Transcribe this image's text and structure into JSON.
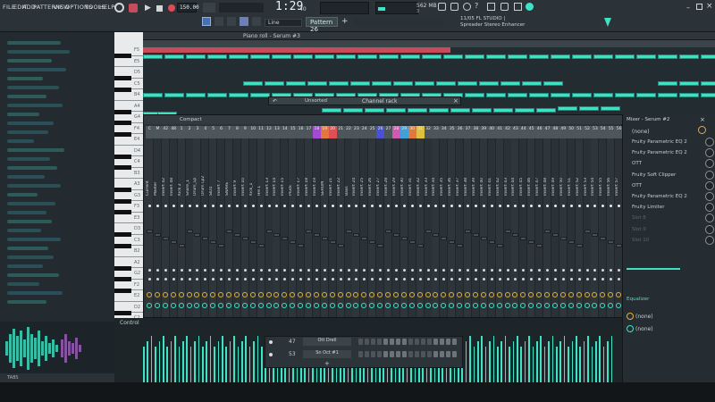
{
  "menu": {
    "file": "FILE",
    "edit": "EDIT",
    "add": "ADD",
    "patterns": "PATTERNS",
    "view": "VIEW",
    "options": "OPTIONS",
    "tools": "TOOLS",
    "help": "HELP"
  },
  "transport": {
    "tempo": "150.00",
    "time": "1:29",
    "time_small": "40",
    "pattern": "Pattern 26",
    "snap": "Line",
    "cpu": "562 MB",
    "cpu_small": "3"
  },
  "hint": {
    "version": "11/05 FL STUDIO |",
    "plugin": "Spreader Stereo Enhancer"
  },
  "piano_roll": {
    "title": "Piano roll - Serum #3"
  },
  "channel_rack": {
    "title": "Channel rack",
    "filter": "Unsorted",
    "compact": "Compact"
  },
  "piano_keys": [
    "F5",
    "E5",
    "D5",
    "C5",
    "B4",
    "A4",
    "G4",
    "F4",
    "E4",
    "D4",
    "C4",
    "B3",
    "A3",
    "G3",
    "F3",
    "E3",
    "D3",
    "C3",
    "B2",
    "A2",
    "G2",
    "F2",
    "E2",
    "D2",
    "C2",
    "B1",
    "A1",
    "G1",
    "F1",
    "E1",
    "D1"
  ],
  "mixer": {
    "track_numbers": [
      "C",
      "M",
      "42",
      "48",
      "1",
      "2",
      "3",
      "4",
      "5",
      "6",
      "7",
      "8",
      "9",
      "10",
      "11",
      "12",
      "13",
      "14",
      "15",
      "16",
      "17",
      "18",
      "19",
      "20",
      "21",
      "22",
      "23",
      "24",
      "25",
      "26",
      "27",
      "28",
      "29",
      "30",
      "31",
      "32",
      "33",
      "34",
      "35",
      "36",
      "37",
      "38",
      "39",
      "40",
      "41",
      "42",
      "43",
      "44",
      "45",
      "46",
      "47",
      "48",
      "49",
      "50",
      "51",
      "52",
      "53",
      "54",
      "55",
      "56",
      "57",
      "58"
    ],
    "track_names": [
      "Current",
      "Master",
      "Insert 42",
      "Insert 48",
      "Kick 2",
      "Snare_1",
      "Drum_Lp",
      "Drum Lp2",
      "SID1",
      "Insert 7",
      "SNARE",
      "Insert 9",
      "Insert 10",
      "Kick_1",
      "HH 1",
      "Insert 13",
      "Insert 14",
      "Insert 15",
      "Pluck",
      "Insert 17",
      "Insert 18",
      "Insert 19",
      "SERUM",
      "Insert 21",
      "Insert 22",
      "Bass",
      "Insert 24",
      "Insert 25",
      "Insert 26",
      "Insert 27",
      "Insert 28",
      "Insert 29",
      "Insert 30",
      "Insert 31",
      "Insert 32",
      "Insert 33",
      "Insert 34",
      "Insert 35",
      "Insert 36",
      "Insert 37",
      "Insert 38",
      "Insert 39",
      "Insert 40",
      "Insert 41",
      "Insert 42",
      "Insert 43",
      "Insert 44",
      "Insert 45",
      "Insert 46",
      "Insert 47",
      "Insert 48",
      "Insert 49",
      "Insert 50",
      "Insert 51",
      "Insert 52",
      "Insert 53",
      "Insert 54",
      "Insert 55",
      "Insert 56",
      "Insert 57",
      "SERUM"
    ]
  },
  "mixer_panel": {
    "title": "Mixer - Serum #2",
    "input": "(none)",
    "slots": [
      "Fruity Parametric EQ 2",
      "Fruity Parametric EQ 2",
      "OTT",
      "Fruity Soft Clipper",
      "OTT",
      "Fruity Parametric EQ 2",
      "Fruity Limiter",
      "Slot 8",
      "Slot 9",
      "Slot 10"
    ],
    "equalizer": "Equalizer",
    "out1": "(none)",
    "out2": "(none)"
  },
  "control": {
    "label": "Control"
  },
  "seq": {
    "row1_label": "Ott Drell",
    "row2_label": "Sn Oct #1",
    "row1_num": "47",
    "row2_num": "53",
    "plus": "+"
  },
  "status": {
    "left": "TABS"
  },
  "colors": {
    "accent": "#3fe2c4",
    "note": "#41e0c2",
    "pattern_bar": "#c94a5a",
    "mixer_bg": "#2b3338"
  }
}
